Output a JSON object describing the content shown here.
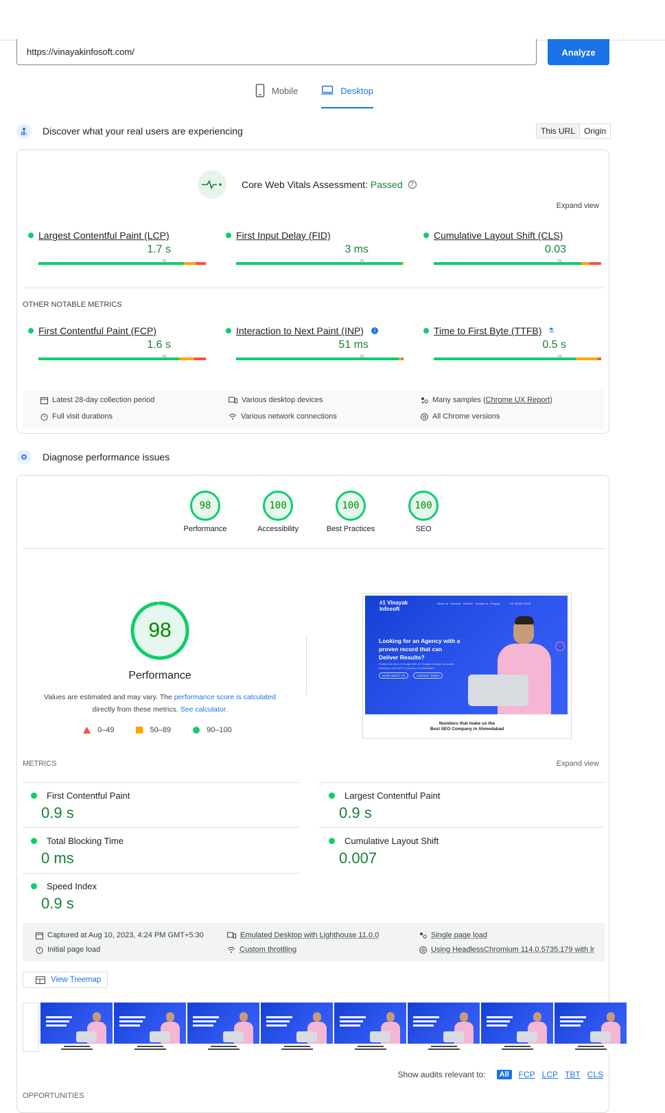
{
  "search": {
    "url_value": "https://vinayakinfosoft.com/",
    "analyze_label": "Analyze"
  },
  "device_tabs": {
    "mobile": "Mobile",
    "desktop": "Desktop"
  },
  "field_section": {
    "heading": "Discover what your real users are experiencing",
    "toggle": {
      "this_url": "This URL",
      "origin": "Origin"
    },
    "assessment_label": "Core Web Vitals Assessment:",
    "assessment_status": "Passed",
    "expand_view": "Expand view",
    "core_metrics": [
      {
        "label": "Largest Contentful Paint (LCP)",
        "value": "1.7 s",
        "good_pct": 87,
        "ni_pct": 7,
        "poor_pct": 6,
        "marker_pct": 75
      },
      {
        "label": "First Input Delay (FID)",
        "value": "3 ms",
        "good_pct": 99,
        "ni_pct": 1,
        "poor_pct": 0,
        "marker_pct": 75
      },
      {
        "label": "Cumulative Layout Shift (CLS)",
        "value": "0.03",
        "good_pct": 88,
        "ni_pct": 5,
        "poor_pct": 7,
        "marker_pct": 75
      }
    ],
    "other_heading": "OTHER NOTABLE METRICS",
    "other_metrics": [
      {
        "label": "First Contentful Paint (FCP)",
        "value": "1.6 s",
        "good_pct": 84,
        "ni_pct": 9,
        "poor_pct": 7,
        "marker_pct": 75
      },
      {
        "label": "Interaction to Next Paint (INP)",
        "value": "51 ms",
        "good_pct": 97,
        "ni_pct": 2,
        "poor_pct": 1,
        "marker_pct": 75
      },
      {
        "label": "Time to First Byte (TTFB)",
        "value": "0.5 s",
        "good_pct": 85,
        "ni_pct": 13,
        "poor_pct": 2,
        "marker_pct": 75
      }
    ],
    "info": {
      "col1": [
        "Latest 28-day collection period",
        "Full visit durations"
      ],
      "col2": [
        "Various desktop devices",
        "Various network connections"
      ],
      "col3_prefix": "Many samples (",
      "col3_link": "Chrome UX Report",
      "col3_suffix": ")",
      "col3_second": "All Chrome versions"
    }
  },
  "lab_section": {
    "heading": "Diagnose performance issues",
    "categories": [
      {
        "score": "98",
        "label": "Performance"
      },
      {
        "score": "100",
        "label": "Accessibility"
      },
      {
        "score": "100",
        "label": "Best Practices"
      },
      {
        "score": "100",
        "label": "SEO"
      }
    ],
    "main_score": "98",
    "main_label": "Performance",
    "note_prefix": "Values are estimated and may vary. The ",
    "note_link1": "performance score is calculated",
    "note_mid": "directly from these metrics. ",
    "note_link2": "See calculator.",
    "legend": [
      "0–49",
      "50–89",
      "90–100"
    ],
    "screenshot": {
      "logo": "#1 Vinayak Infosoft",
      "nav": "About us   Services   Careers   Contact us   Enquiry",
      "phone": "+91 94265 40078",
      "headline": "Looking for an Agency with a proven record that can Deliver Results?",
      "sub": "Realize the best of Google with #1 Vinayak Infosoft, an award-winning & best SEO Company in Ahmedabad",
      "btn1": "MORE ABOUT US",
      "btn2": "CONTACT TODAY",
      "caption_line1": "Numbers that make us the",
      "caption_line2": "Best SEO Company in Ahmedabad"
    },
    "metrics_heading": "METRICS",
    "metrics_expand": "Expand view",
    "metrics": [
      {
        "label": "First Contentful Paint",
        "value": "0.9 s"
      },
      {
        "label": "Largest Contentful Paint",
        "value": "0.9 s"
      },
      {
        "label": "Total Blocking Time",
        "value": "0 ms"
      },
      {
        "label": "Cumulative Layout Shift",
        "value": "0.007"
      },
      {
        "label": "Speed Index",
        "value": "0.9 s"
      }
    ],
    "env": {
      "captured": "Captured at Aug 10, 2023, 4:24 PM GMT+5:30",
      "initial": "Initial page load",
      "emulated": "Emulated Desktop with Lighthouse 11.0.0",
      "throttling": "Custom throttling",
      "single": "Single page load",
      "using": "Using HeadlessChromium 114.0.5735.179 with lr"
    },
    "treemap_label": "View Treemap",
    "filter_label": "Show audits relevant to:",
    "filters": [
      "All",
      "FCP",
      "LCP",
      "TBT",
      "CLS"
    ],
    "opportunities_heading": "OPPORTUNITIES"
  },
  "colors": {
    "good": "#0cce6b",
    "average": "#ffa400",
    "poor": "#ff4e42",
    "accent": "#1a73e8"
  }
}
